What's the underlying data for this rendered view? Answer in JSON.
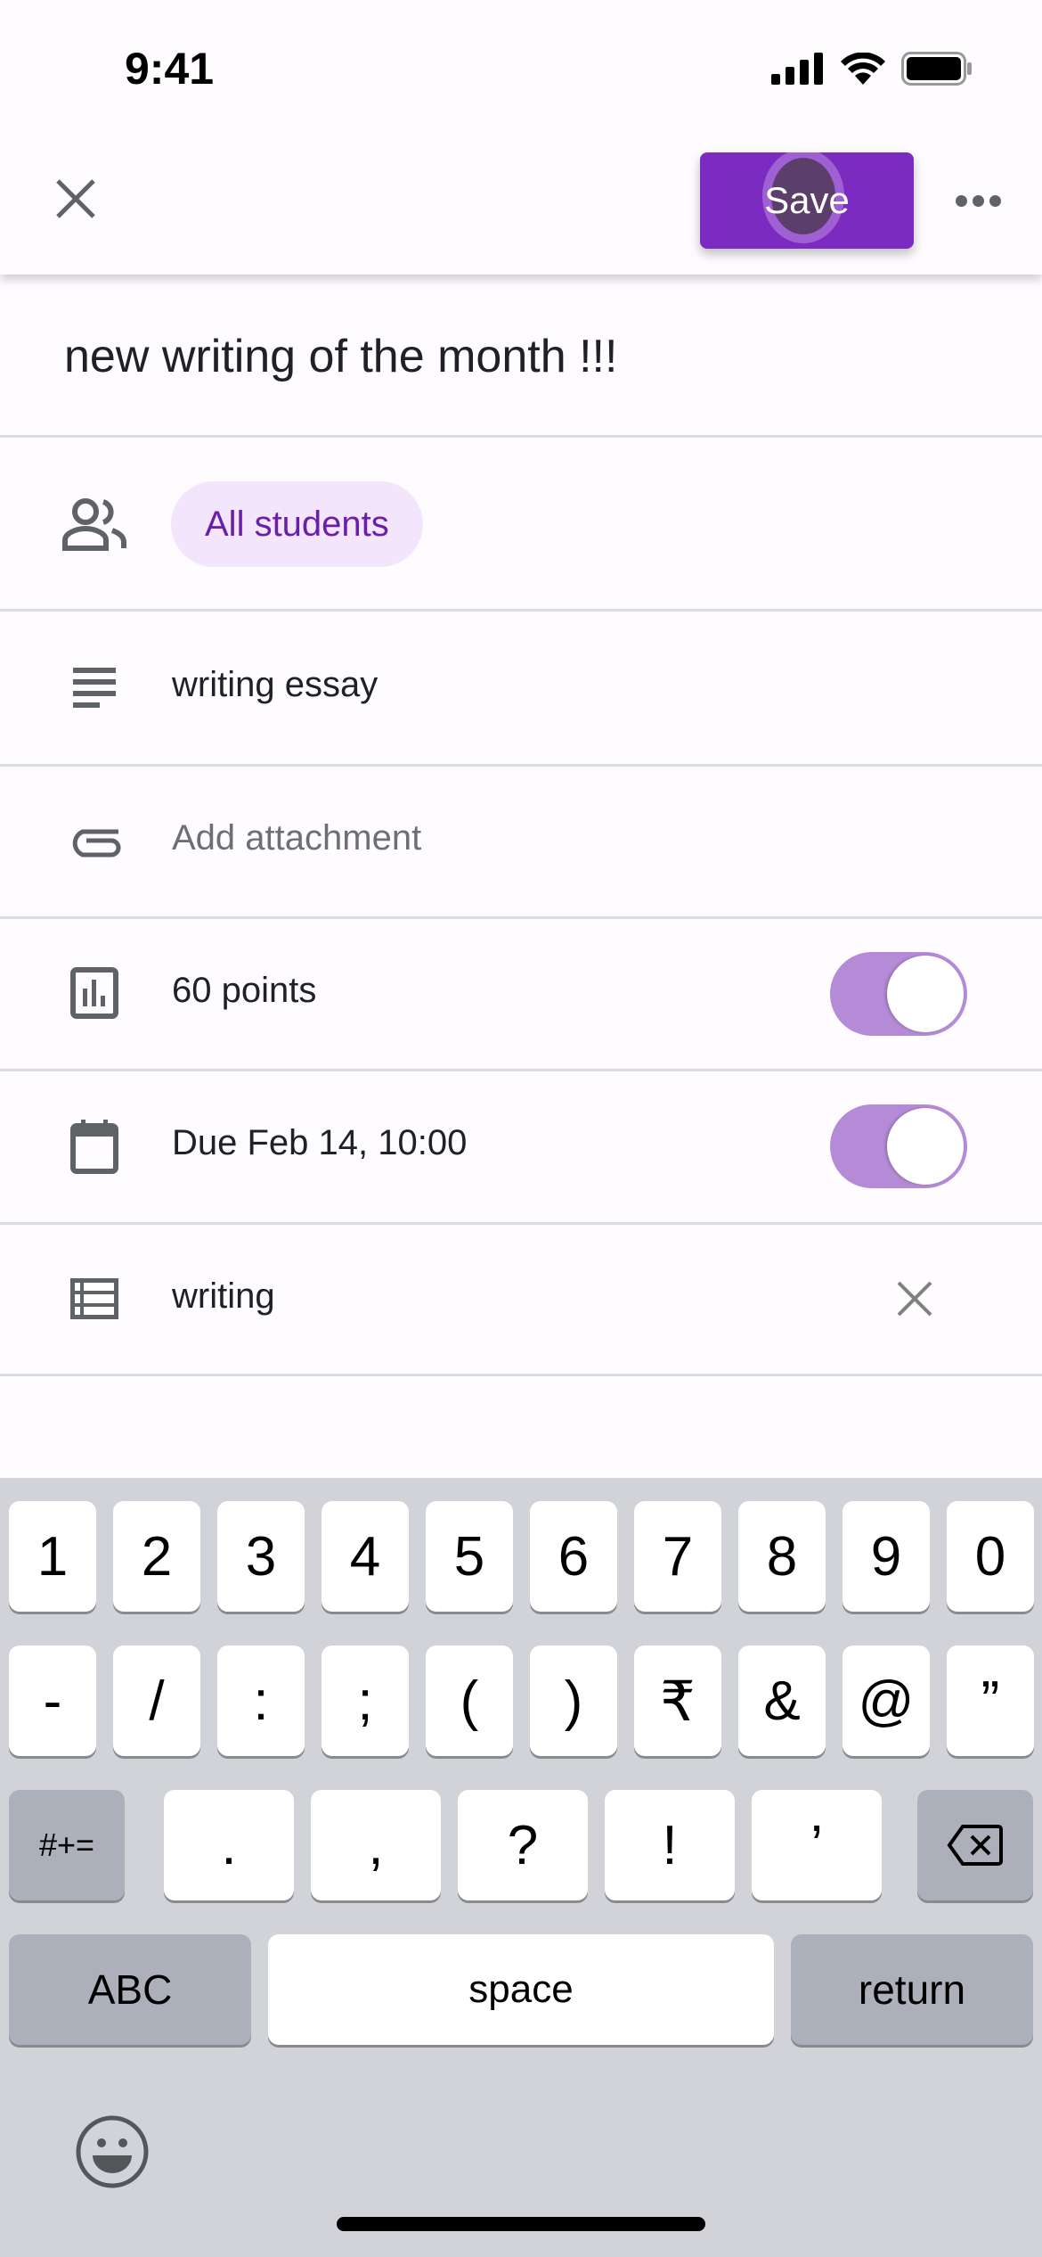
{
  "status_bar": {
    "time": "9:41"
  },
  "topbar": {
    "save_label": "Save"
  },
  "form": {
    "title": "new writing of the month !!!",
    "audience_chip": "All students",
    "description": "writing essay",
    "attachment_placeholder": "Add attachment",
    "points": "60 points",
    "points_enabled": true,
    "due": "Due Feb 14, 10:00",
    "due_enabled": true,
    "topic": "writing"
  },
  "colors": {
    "accent": "#7b2bbf",
    "chip_bg": "#f3e5fb",
    "chip_text": "#6a1fa8",
    "toggle_track": "#b58ad6"
  },
  "keyboard": {
    "row1": [
      "1",
      "2",
      "3",
      "4",
      "5",
      "6",
      "7",
      "8",
      "9",
      "0"
    ],
    "row2": [
      "-",
      "/",
      ":",
      ";",
      "(",
      ")",
      "₹",
      "&",
      "@",
      "”"
    ],
    "row3_mode": "#+=",
    "row3": [
      ".",
      ",",
      "?",
      "!",
      "’"
    ],
    "abc": "ABC",
    "space": "space",
    "return": "return"
  }
}
